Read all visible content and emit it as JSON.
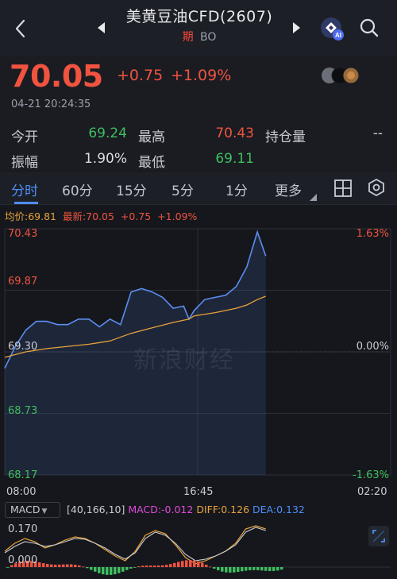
{
  "header": {
    "title": "美黄豆油CFD(2607)",
    "badge": "期",
    "code": "BO"
  },
  "quote": {
    "price": "70.05",
    "change": "+0.75",
    "change_pct": "+1.09%",
    "time": "04-21 20:24:35"
  },
  "stats": [
    {
      "label": "今开",
      "value": "69.24",
      "color": "#3fbf5f"
    },
    {
      "label": "最高",
      "value": "70.43",
      "color": "#f0533f"
    },
    {
      "label": "持仓量",
      "value": "--",
      "color": "#c9ccd3"
    },
    {
      "label": "振幅",
      "value": "1.90%",
      "color": "#d8dbe2"
    },
    {
      "label": "最低",
      "value": "69.11",
      "color": "#3fbf5f"
    }
  ],
  "tabs": [
    "分时",
    "60分",
    "15分",
    "5分",
    "1分",
    "更多"
  ],
  "legend": {
    "avg": "均价:69.81",
    "latest": "最新:70.05",
    "change": "+0.75",
    "change_pct": "+1.09%"
  },
  "watermark": "新浪财经",
  "chart_data": {
    "type": "line",
    "series": [
      {
        "name": "最新",
        "color": "#5b8ef0",
        "x": [
          "08:00",
          "08:30",
          "09:00",
          "09:30",
          "10:00",
          "10:30",
          "11:00",
          "11:30",
          "12:00",
          "12:30",
          "13:00",
          "13:30",
          "14:00",
          "14:30",
          "15:00",
          "15:30",
          "16:00",
          "16:30",
          "16:45",
          "17:00",
          "17:30",
          "18:00",
          "18:30",
          "19:00",
          "19:30",
          "20:00",
          "20:24"
        ],
        "y": [
          69.15,
          69.35,
          69.5,
          69.58,
          69.58,
          69.55,
          69.55,
          69.6,
          69.6,
          69.53,
          69.6,
          69.55,
          69.85,
          69.88,
          69.85,
          69.8,
          69.7,
          69.72,
          69.6,
          69.68,
          69.78,
          69.8,
          69.82,
          69.9,
          70.08,
          70.4,
          70.18
        ]
      },
      {
        "name": "均价",
        "color": "#e8a33a",
        "x": [
          "08:00",
          "09:00",
          "10:00",
          "11:00",
          "12:00",
          "13:00",
          "14:00",
          "15:00",
          "16:00",
          "16:45",
          "17:00",
          "18:00",
          "19:00",
          "19:30",
          "20:00",
          "20:24"
        ],
        "y": [
          69.25,
          69.3,
          69.33,
          69.35,
          69.37,
          69.4,
          69.47,
          69.52,
          69.57,
          69.6,
          69.63,
          69.66,
          69.7,
          69.73,
          69.78,
          69.81
        ]
      }
    ],
    "y_ticks_left": [
      "70.43",
      "69.87",
      "69.30",
      "68.73",
      "68.17"
    ],
    "y_ticks_right": [
      "1.63%",
      "0.00%",
      "-1.63%"
    ],
    "x_ticks": [
      "08:00",
      "16:45",
      "02:20"
    ],
    "ylim": [
      68.17,
      70.43
    ]
  },
  "macd": {
    "label": "MACD",
    "params": "[40,166,10]",
    "macd": "MACD:-0.012",
    "diff": "DIFF:0.126",
    "dea": "DEA:0.132",
    "y_ticks": [
      "0.170",
      "0.000"
    ]
  },
  "colors": {
    "up": "#f0533f",
    "down": "#3fbf5f",
    "accent": "#4f8ef7",
    "background": "#15171d"
  }
}
